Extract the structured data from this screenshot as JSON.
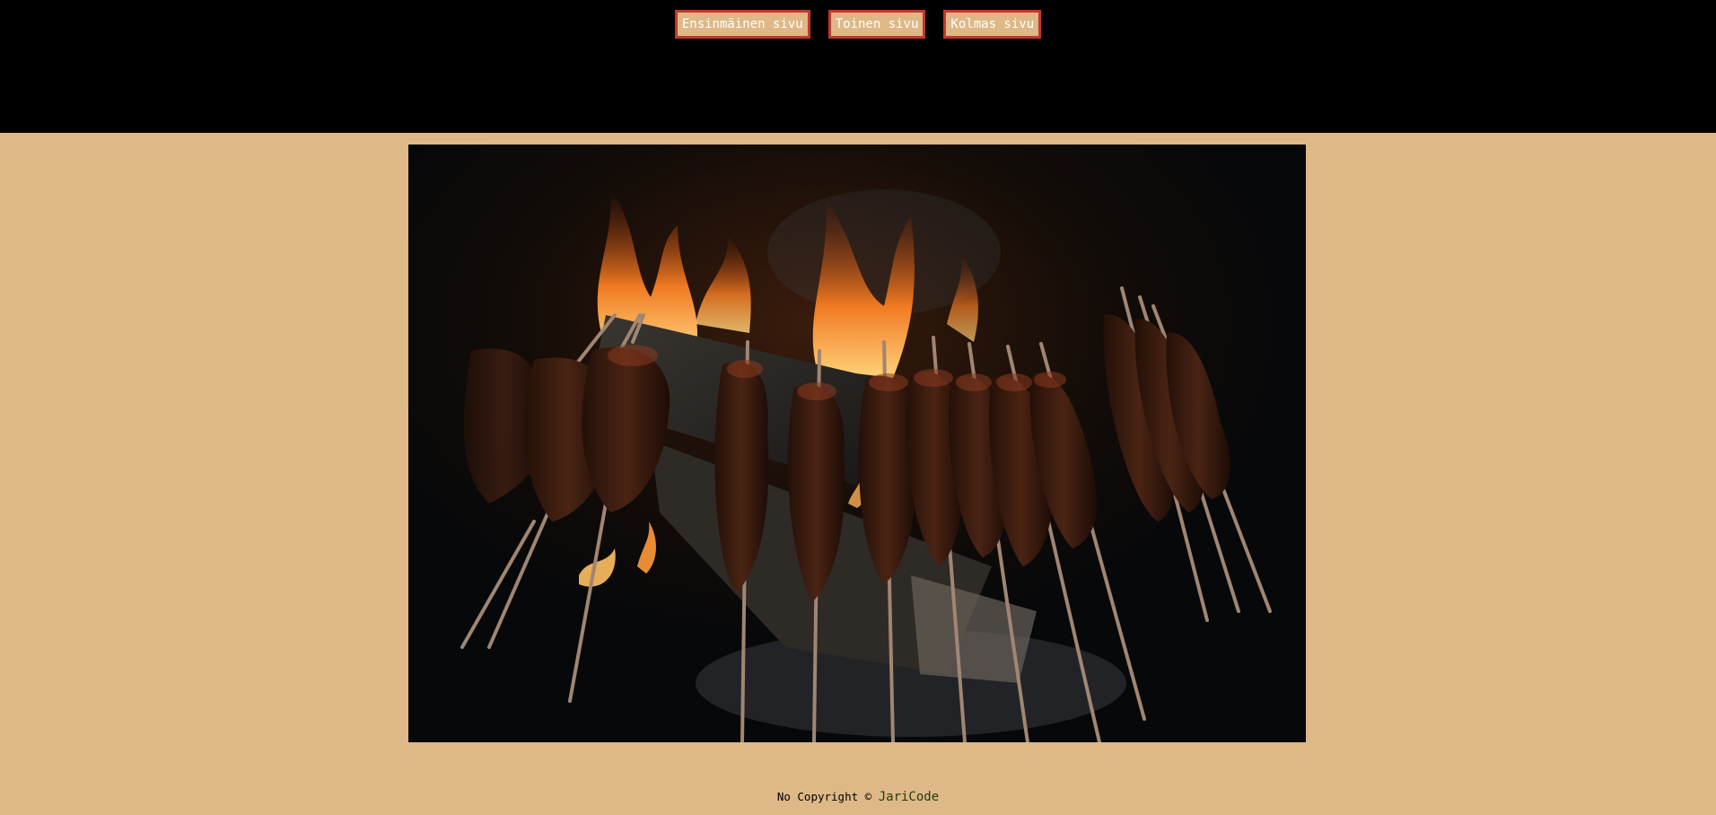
{
  "nav": {
    "items": [
      {
        "label": "Ensinmäinen sivu"
      },
      {
        "label": "Toinen sivu"
      },
      {
        "label": "Kolmas sivu"
      }
    ]
  },
  "hero": {
    "alt": "Grilled meat skewers over an open fire"
  },
  "footer": {
    "text": "No Copyright © ",
    "author": "JariCode"
  },
  "colors": {
    "page_background": "#deb887",
    "header_background": "#000000",
    "button_border": "#c0392b",
    "author_link": "#1e3a0a"
  }
}
